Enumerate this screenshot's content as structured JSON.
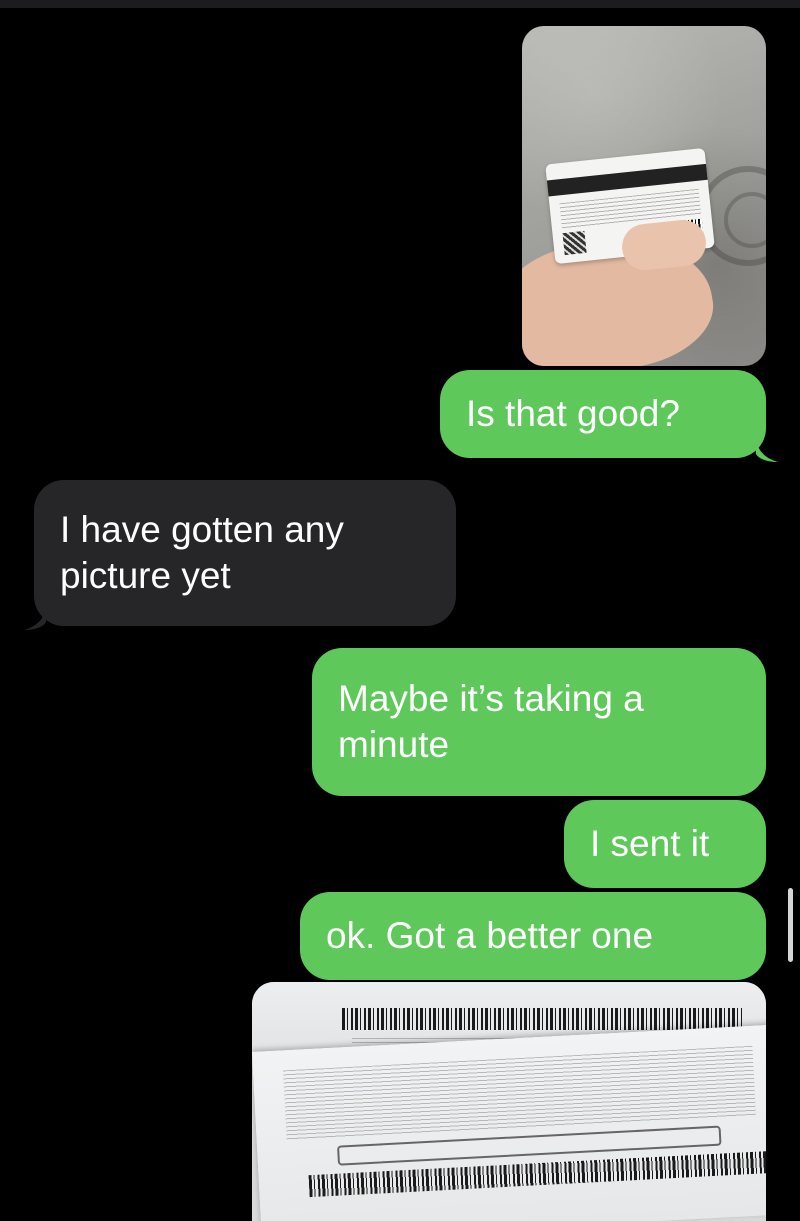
{
  "conversation": {
    "messages": [
      {
        "direction": "outgoing",
        "kind": "image",
        "image_name": "gift-card-back-photo"
      },
      {
        "direction": "outgoing",
        "kind": "text",
        "text": "Is that good?"
      },
      {
        "direction": "incoming",
        "kind": "text",
        "text": "I have gotten any picture yet"
      },
      {
        "direction": "outgoing",
        "kind": "text",
        "text": "Maybe it’s taking a minute"
      },
      {
        "direction": "outgoing",
        "kind": "text",
        "text": "I sent it"
      },
      {
        "direction": "outgoing",
        "kind": "text",
        "text": "ok. Got a better one"
      },
      {
        "direction": "outgoing",
        "kind": "image",
        "image_name": "gift-card-pin-closeup-photo"
      }
    ]
  },
  "colors": {
    "background": "#000000",
    "sent_bubble": "#5fc85b",
    "received_bubble": "#262628",
    "text": "#ffffff"
  }
}
